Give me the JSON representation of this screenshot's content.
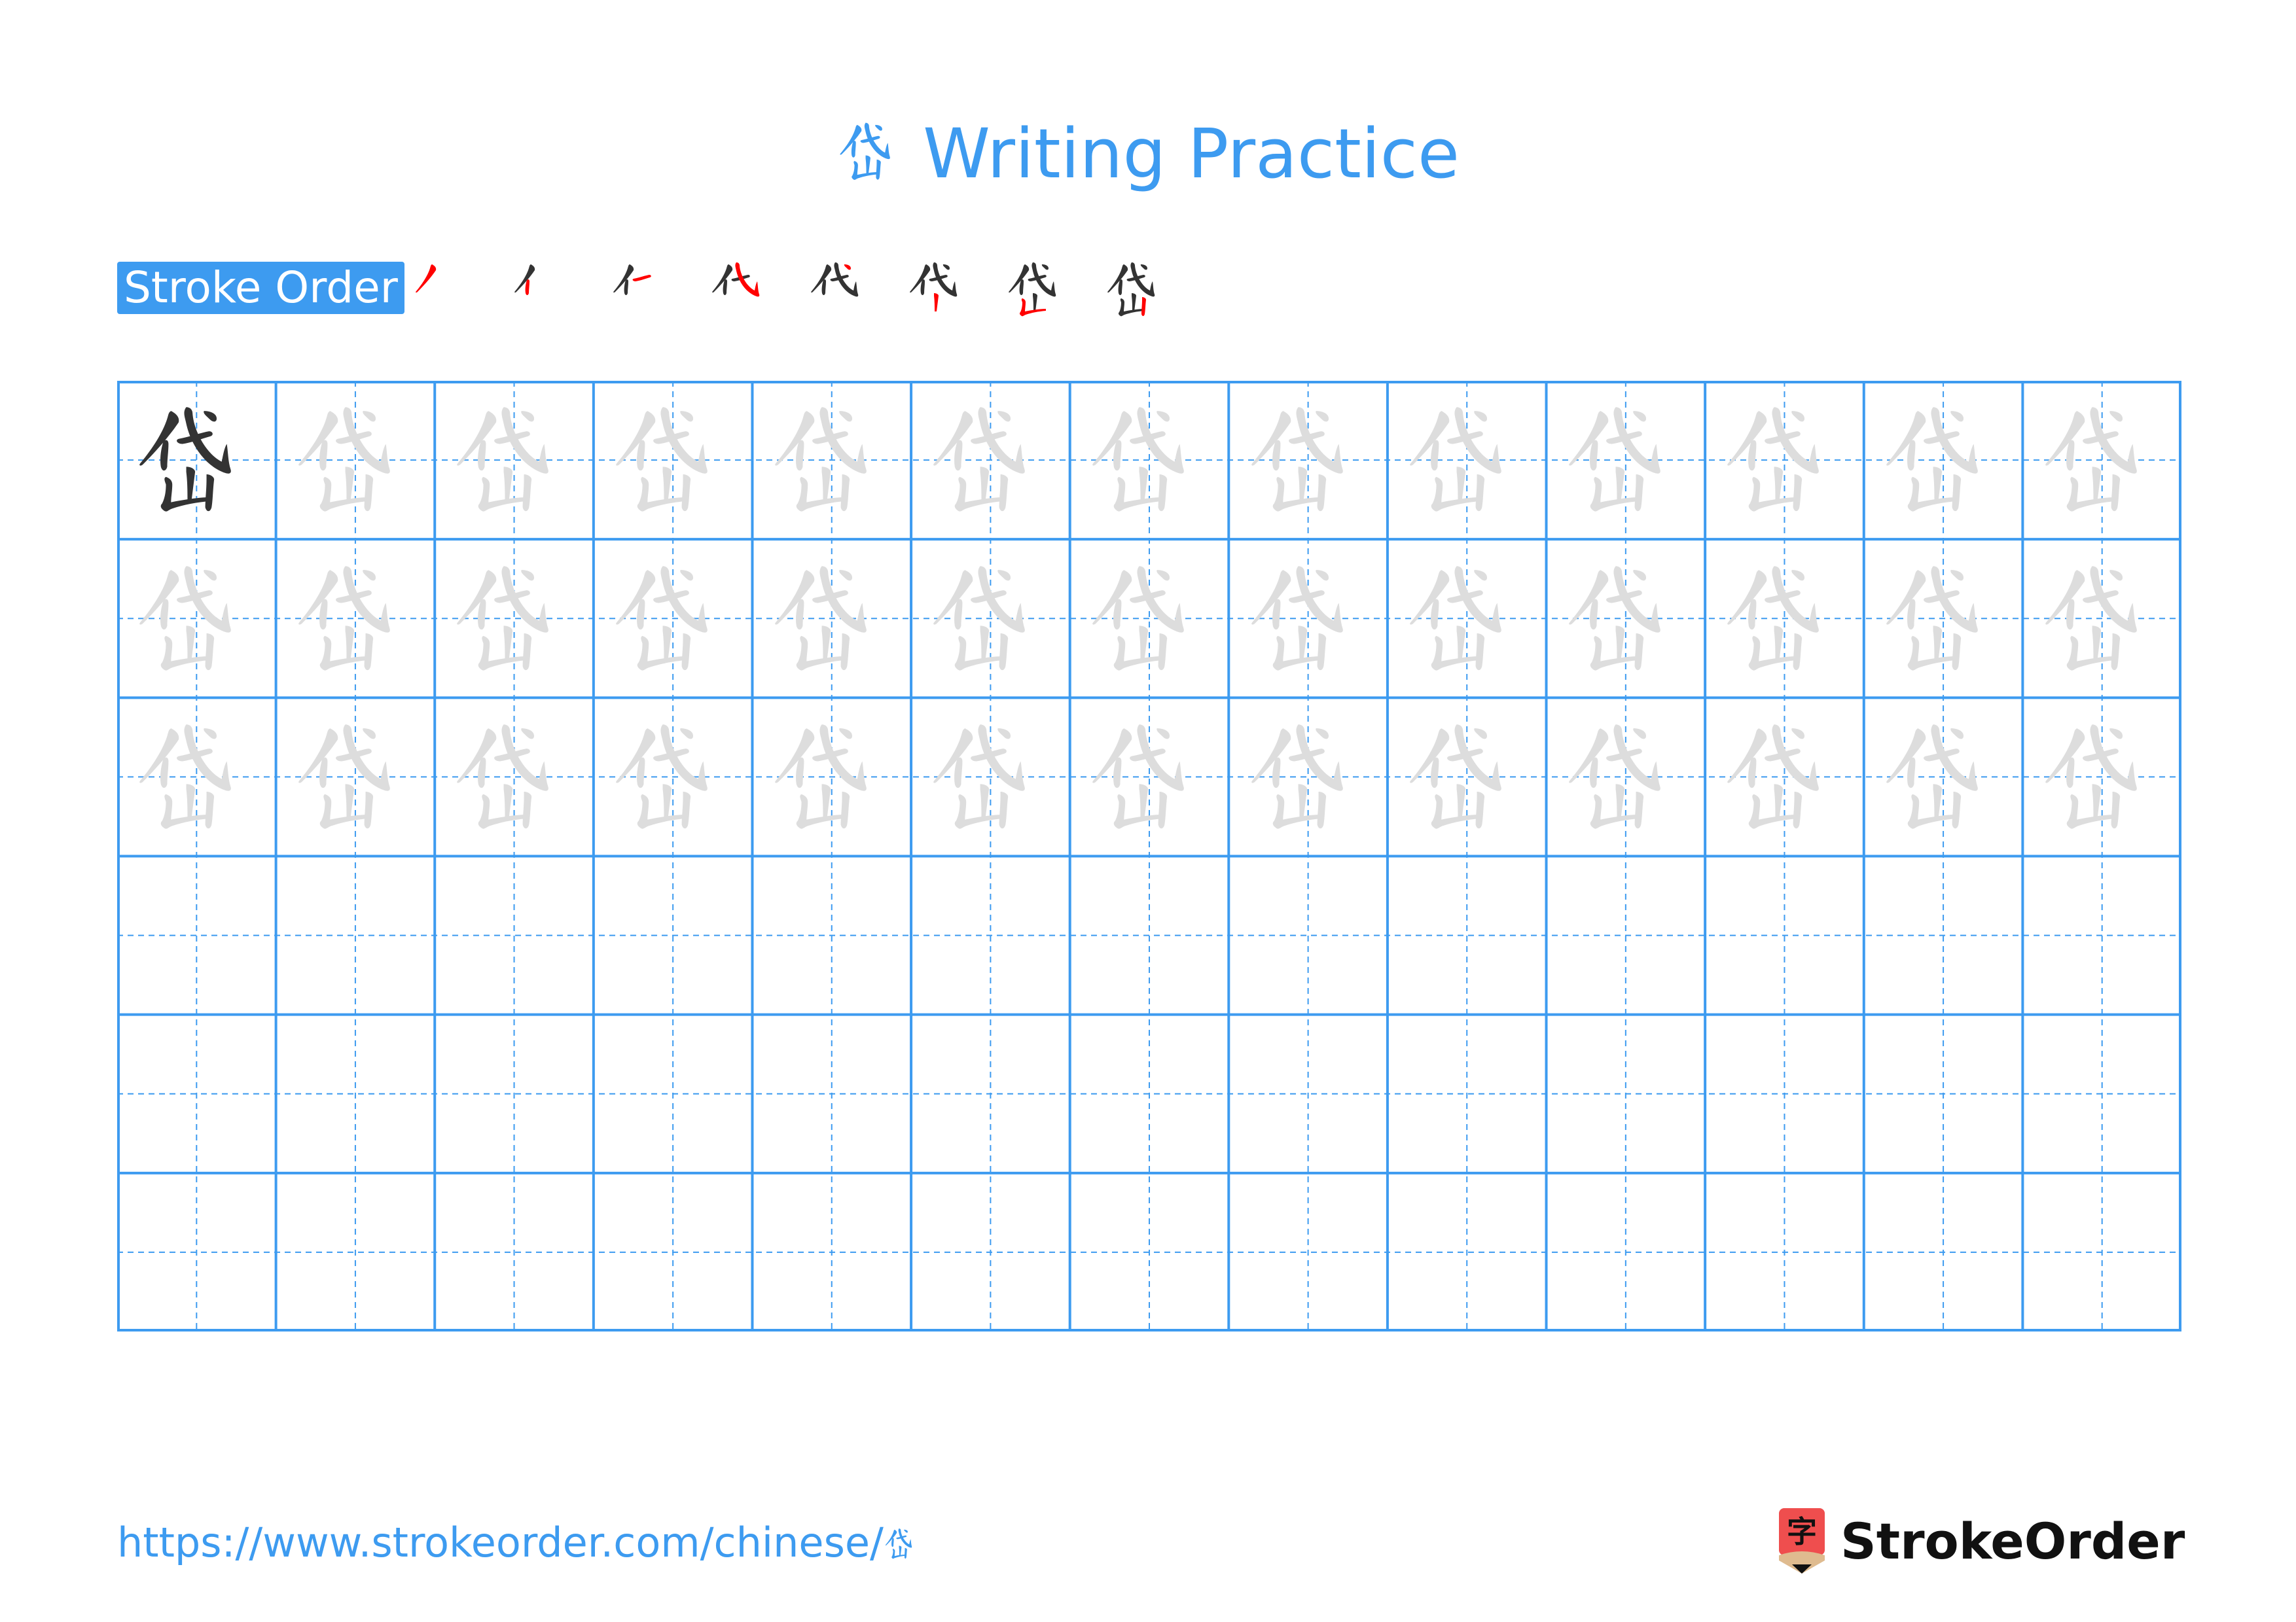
{
  "page": {
    "character": "岱",
    "title_suffix": "Writing Practice",
    "accent_color": "#3d9bf0"
  },
  "stroke_order": {
    "label": "Stroke Order",
    "step_count": 8,
    "highlight_color": "#ff0000",
    "done_color": "#333333"
  },
  "grid": {
    "columns": 13,
    "rows": 6,
    "model_cells": 1,
    "trace_rows": 3,
    "empty_rows": 3,
    "model_color": "#333333",
    "trace_color": "#dddddd",
    "line_color": "#3d9bf0"
  },
  "footer": {
    "url_prefix": "https://www.strokeorder.com/chinese/",
    "url_char": "岱",
    "brand": "StrokeOrder",
    "logo_char": "字"
  }
}
